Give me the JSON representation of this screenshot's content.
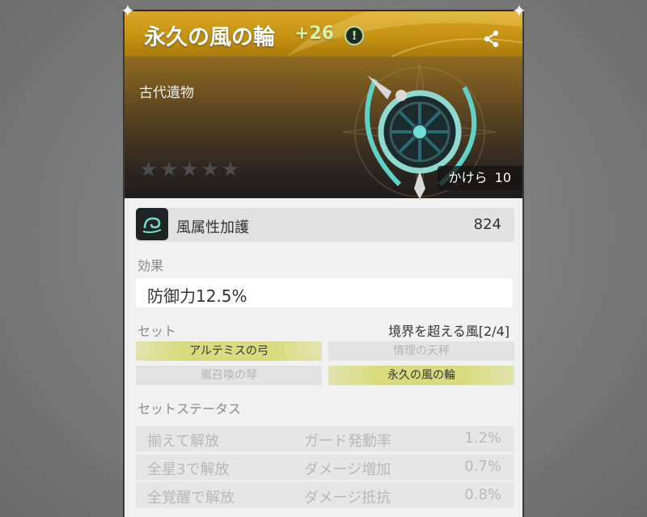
{
  "header": {
    "title": "永久の風の輪",
    "level": "+26"
  },
  "banner": {
    "category": "古代遺物",
    "rarity_stars": 5,
    "rarity_filled": 0,
    "points_label": "かけら",
    "points_value": "10"
  },
  "main_stat": {
    "name": "風属性加護",
    "value": "824"
  },
  "effect": {
    "label": "効果",
    "text": "防御力12.5%"
  },
  "set": {
    "label": "セット",
    "name": "境界を超える風[2/4]",
    "pieces": [
      {
        "name": "アルテミスの弓",
        "active": true
      },
      {
        "name": "情理の天秤",
        "active": false
      },
      {
        "name": "嵐召喚の琴",
        "active": false
      },
      {
        "name": "永久の風の輪",
        "active": true
      }
    ]
  },
  "set_status": {
    "label": "セットステータス",
    "rows": [
      {
        "condition": "揃えて解放",
        "stat": "ガード発動率",
        "value": "1.2%"
      },
      {
        "condition": "全星3で解放",
        "stat": "ダメージ増加",
        "value": "0.7%"
      },
      {
        "condition": "全覚醒で解放",
        "stat": "ダメージ抵抗",
        "value": "0.8%"
      }
    ]
  },
  "colors": {
    "header_gold": "#c89514",
    "level_green": "#d9f0a8",
    "set_active": "#d9dc7e",
    "panel_bg": "#f1f1f1"
  }
}
